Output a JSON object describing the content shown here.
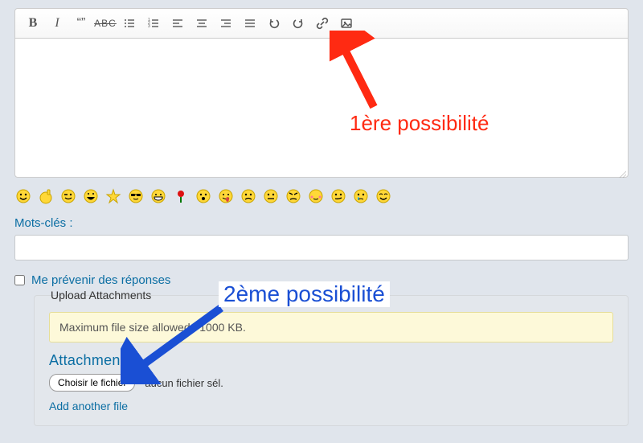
{
  "toolbar": {
    "bold": "B",
    "italic": "I",
    "quote": "❝❞",
    "strike": "ABC"
  },
  "keywords": {
    "label": "Mots-clés :",
    "value": ""
  },
  "notify": {
    "label": "Me prévenir des réponses"
  },
  "upload": {
    "legend": "Upload Attachments",
    "filesize": "Maximum file size allowed : 1000 KB.",
    "heading": "Attachments",
    "choose_label": "Choisir le fichier",
    "status": "aucun fichier sél.",
    "add_another": "Add another file"
  },
  "annotations": {
    "one": "1ère possibilité",
    "two": "2ème possibilité"
  }
}
